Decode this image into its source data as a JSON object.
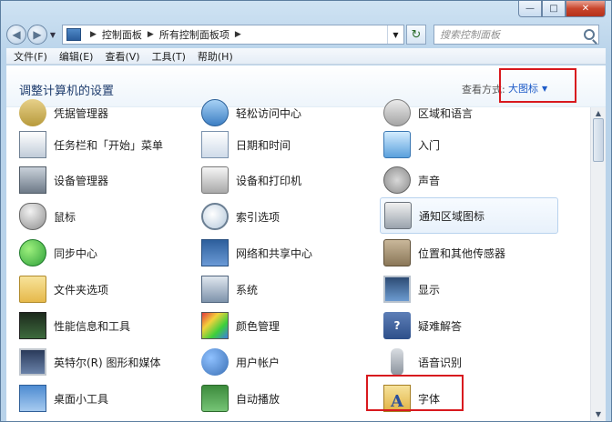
{
  "window": {
    "caption_buttons": [
      "—",
      "□",
      "✕"
    ]
  },
  "address": {
    "breadcrumbs": [
      "控制面板",
      "所有控制面板项"
    ],
    "search_placeholder": "搜索控制面板"
  },
  "menubar": {
    "items": [
      "文件(F)",
      "编辑(E)",
      "查看(V)",
      "工具(T)",
      "帮助(H)"
    ]
  },
  "header": {
    "title": "调整计算机的设置",
    "view_by_label": "查看方式:",
    "view_by_value": "大图标"
  },
  "items": {
    "row0": [
      "凭据管理器",
      "轻松访问中心",
      "区域和语言"
    ],
    "row1": [
      "任务栏和「开始」菜单",
      "日期和时间",
      "入门"
    ],
    "row2": [
      "设备管理器",
      "设备和打印机",
      "声音"
    ],
    "row3": [
      "鼠标",
      "索引选项",
      "通知区域图标"
    ],
    "row4": [
      "同步中心",
      "网络和共享中心",
      "位置和其他传感器"
    ],
    "row5": [
      "文件夹选项",
      "系统",
      "显示"
    ],
    "row6": [
      "性能信息和工具",
      "颜色管理",
      "疑难解答"
    ],
    "row7": [
      "英特尔(R) 图形和媒体",
      "用户帐户",
      "语音识别"
    ],
    "row8": [
      "桌面小工具",
      "自动播放",
      "字体"
    ]
  },
  "colors": {
    "highlight_box": "#d8191e",
    "link_blue": "#1f5cc8",
    "title_blue": "#1e3c6d"
  }
}
